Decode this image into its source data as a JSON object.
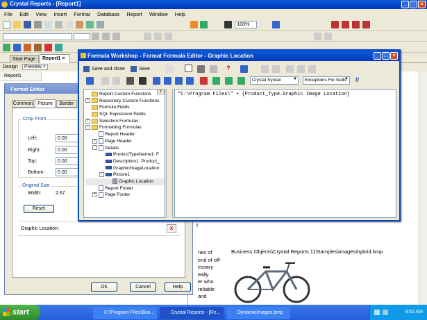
{
  "app": {
    "title": "Crystal Reports - [Report1]",
    "menus": [
      "File",
      "Edit",
      "View",
      "Insert",
      "Format",
      "Database",
      "Report",
      "Window",
      "Help"
    ],
    "zoom": "100%"
  },
  "doc_tabs": [
    {
      "label": "Start Page"
    },
    {
      "label": "Report1"
    }
  ],
  "view_tabs": {
    "design": "Design",
    "preview": "Preview"
  },
  "preview_header": "Report1",
  "format_editor": {
    "title": "Format Editor",
    "tabs": [
      "Common",
      "Picture",
      "Border",
      "H"
    ],
    "crop_from": "Crop From",
    "labels": {
      "left": "Left:",
      "right": "Right:",
      "top": "Top:",
      "bottom": "Bottom:"
    },
    "values": {
      "left": "0.00",
      "right": "0.00",
      "top": "0.00",
      "bottom": "0.00"
    },
    "original_size": "Original Size",
    "width_label": "Width:",
    "width_value": "2.67",
    "reset": "Reset",
    "graphic_location": "Graphic Location:",
    "ok": "OK",
    "cancel": "Cancel",
    "help": "Help"
  },
  "formula_workshop": {
    "title": "Formula Workshop - Format Formula Editor - Graphic Location",
    "save_and_close": "Save and close",
    "save": "Save",
    "syntax": "Crystal Syntax",
    "nulls": "Exceptions For Nulls",
    "formula_text": "\"C:\\Program Files\\\" + {Product_Type.Graphic Image Location}",
    "tree": [
      {
        "label": "Report Custom Functions",
        "level": 0,
        "type": "folder",
        "exp": ""
      },
      {
        "label": "Repository Custom Functions",
        "level": 0,
        "type": "folder",
        "exp": "+"
      },
      {
        "label": "Formula Fields",
        "level": 0,
        "type": "folder",
        "exp": ""
      },
      {
        "label": "SQL Expression Fields",
        "level": 0,
        "type": "folder",
        "exp": ""
      },
      {
        "label": "Selection Formulas",
        "level": 0,
        "type": "folder",
        "exp": "+"
      },
      {
        "label": "Formatting Formulas",
        "level": 0,
        "type": "folder",
        "exp": "-"
      },
      {
        "label": "Report Header",
        "level": 1,
        "type": "doc",
        "exp": ""
      },
      {
        "label": "Page Header",
        "level": 1,
        "type": "doc",
        "exp": "+"
      },
      {
        "label": "Details",
        "level": 1,
        "type": "doc",
        "exp": "-"
      },
      {
        "label": "ProductTypeName1: F",
        "level": 2,
        "type": "field",
        "exp": ""
      },
      {
        "label": "Description1: Product_",
        "level": 2,
        "type": "field",
        "exp": ""
      },
      {
        "label": "GraphicImageLocation",
        "level": 2,
        "type": "field",
        "exp": ""
      },
      {
        "label": "Picture1",
        "level": 2,
        "type": "pic",
        "exp": "-"
      },
      {
        "label": "Graphic Location",
        "level": 3,
        "type": "formula",
        "exp": ""
      },
      {
        "label": "Report Footer",
        "level": 1,
        "type": "doc",
        "exp": ""
      },
      {
        "label": "Page Footer",
        "level": 1,
        "type": "doc",
        "exp": "+"
      }
    ]
  },
  "report_preview": {
    "path_text": "Business Objects\\Crystal Reports 11\\Samples\\images\\hybrid.bmp",
    "left_snippets": [
      "nes of",
      "end of off-",
      "essary",
      "eally",
      "er who",
      "reliable",
      "and"
    ],
    "r_char": "r"
  },
  "taskbar": {
    "start": "start",
    "items": [
      "C:\\Program Files\\Bus...",
      "Crystal Reports - [Re...",
      "DynamicImages.bmp"
    ],
    "time": "9:50 AM"
  },
  "colors": {
    "title_blue": "#0a5bdb",
    "xp_face": "#ece9d8",
    "taskbar_blue": "#245edb",
    "start_green": "#3c9a3c"
  }
}
